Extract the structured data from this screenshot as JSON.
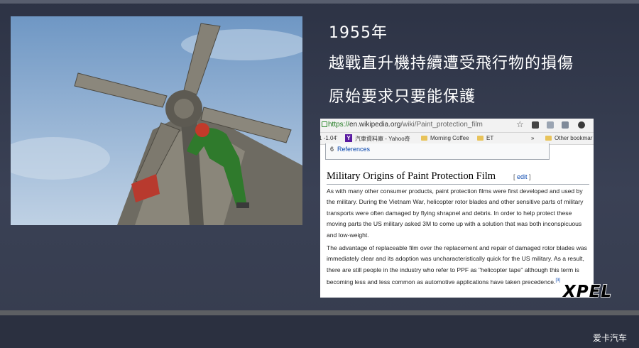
{
  "slide": {
    "lines": [
      "1955年",
      "越戰直升機持續遭受飛行物的損傷",
      "原始要求只要能保護"
    ]
  },
  "browser": {
    "url_protocol": "https://",
    "url_host": "en.wikipedia.org",
    "url_path": "/wiki/Paint_protection_film",
    "bookmarks": {
      "left_fragment": "1 -1.04'",
      "yahoo_badge": "Y",
      "yahoo": "汽車資料庫 - Yahoo奇",
      "morning_coffee": "Morning Coffee",
      "et": "ET",
      "chevron": "»",
      "other": "Other bookmar"
    },
    "toc": {
      "number": "6",
      "label": "References"
    },
    "heading": "Military Origins of Paint Protection Film",
    "edit": {
      "open": "[ ",
      "label": "edit",
      "close": " ]"
    },
    "paragraph1": "As with many other consumer products, paint protection films were first developed and used by the military. During the Vietnam War, helicopter rotor blades and other sensitive parts of military transports were often damaged by flying shrapnel and debris. In order to help protect these moving parts the US military asked 3M to come up with a solution that was both inconspicuous and low-weight.",
    "paragraph2": "The advantage of replaceable film over the replacement and repair of damaged rotor blades was immediately clear and its adoption was uncharacteristically quick for the US military. As a result, there are still people in the industry who refer to PPF as \"helicopter tape\" although this term is becoming less and less common as automotive applications have taken precedence.",
    "citation": "[3]"
  },
  "logo": {
    "text": "XPEL"
  },
  "watermark": "爱卡汽车",
  "icons": [
    "lock-icon",
    "star-icon",
    "extension-icon",
    "folder-icon",
    "yahoo-icon"
  ],
  "colors": {
    "background": "#363c4e",
    "link": "#0645ad",
    "heading_rule": "#a2a9b1",
    "flight_suit": "#2f7a2c"
  }
}
